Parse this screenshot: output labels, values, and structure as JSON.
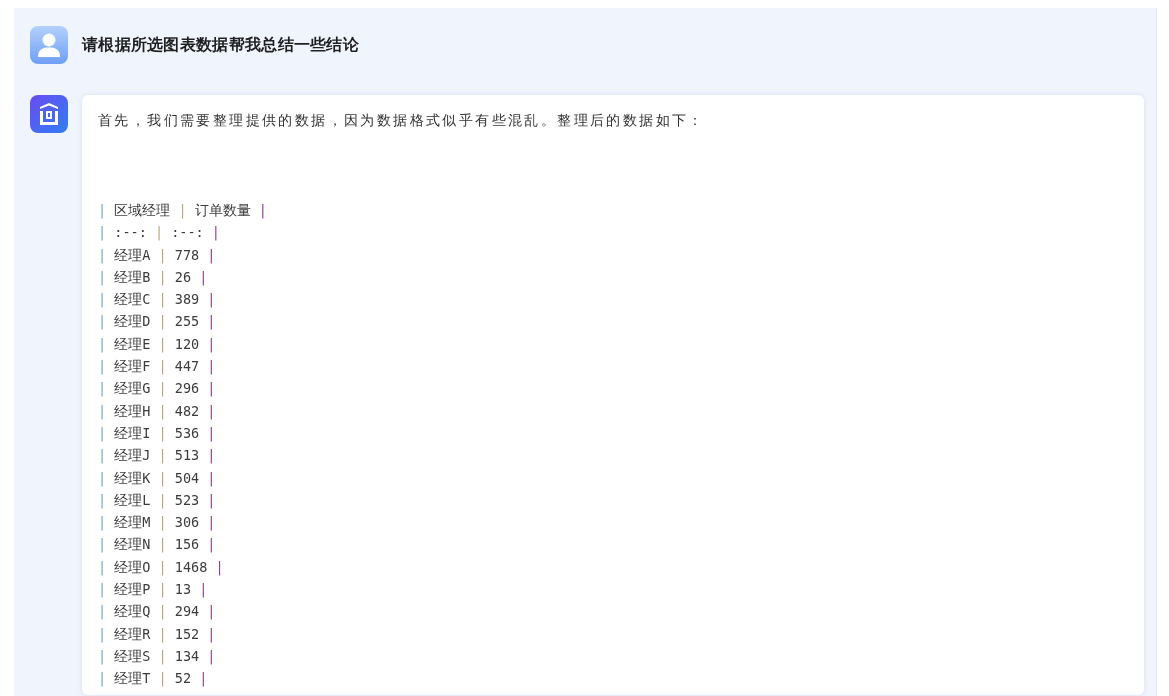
{
  "question": {
    "text": "请根据所选图表数据帮我总结一些结论"
  },
  "answer": {
    "intro": "首先，我们需要整理提供的数据，因为数据格式似乎有些混乱。整理后的数据如下：",
    "table_lines": [
      "| 区域经理 | 订单数量 |",
      "| :--: | :--: |",
      "| 经理A | 778 |",
      "| 经理B | 26 |",
      "| 经理C | 389 |",
      "| 经理D | 255 |",
      "| 经理E | 120 |",
      "| 经理F | 447 |",
      "| 经理G | 296 |",
      "| 经理H | 482 |",
      "| 经理I | 536 |",
      "| 经理J | 513 |",
      "| 经理K | 504 |",
      "| 经理L | 523 |",
      "| 经理M | 306 |",
      "| 经理N | 156 |",
      "| 经理O | 1468 |",
      "| 经理P | 13 |",
      "| 经理Q | 294 |",
      "| 经理R | 152 |",
      "| 经理S | 134 |",
      "| 经理T | 52 |"
    ]
  }
}
